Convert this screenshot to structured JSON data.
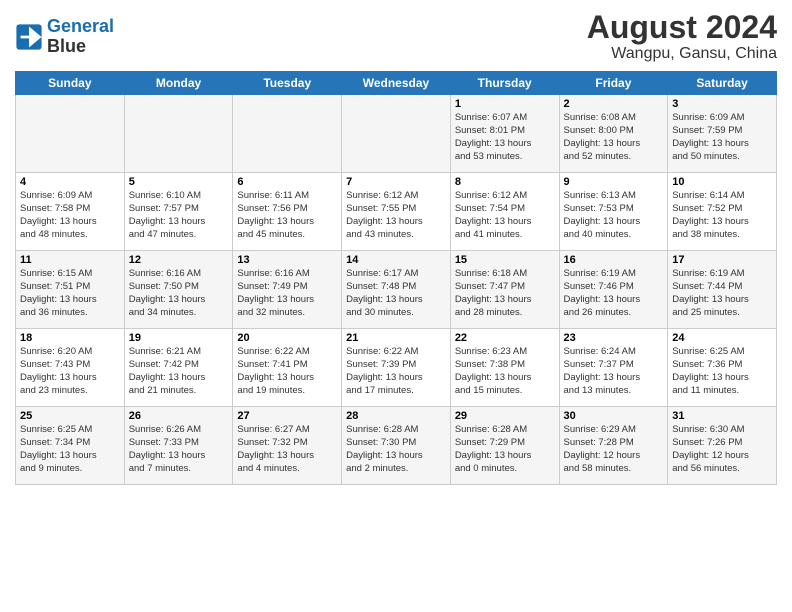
{
  "header": {
    "logo_line1": "General",
    "logo_line2": "Blue",
    "month_year": "August 2024",
    "location": "Wangpu, Gansu, China"
  },
  "weekdays": [
    "Sunday",
    "Monday",
    "Tuesday",
    "Wednesday",
    "Thursday",
    "Friday",
    "Saturday"
  ],
  "weeks": [
    [
      {
        "day": "",
        "info": ""
      },
      {
        "day": "",
        "info": ""
      },
      {
        "day": "",
        "info": ""
      },
      {
        "day": "",
        "info": ""
      },
      {
        "day": "1",
        "info": "Sunrise: 6:07 AM\nSunset: 8:01 PM\nDaylight: 13 hours\nand 53 minutes."
      },
      {
        "day": "2",
        "info": "Sunrise: 6:08 AM\nSunset: 8:00 PM\nDaylight: 13 hours\nand 52 minutes."
      },
      {
        "day": "3",
        "info": "Sunrise: 6:09 AM\nSunset: 7:59 PM\nDaylight: 13 hours\nand 50 minutes."
      }
    ],
    [
      {
        "day": "4",
        "info": "Sunrise: 6:09 AM\nSunset: 7:58 PM\nDaylight: 13 hours\nand 48 minutes."
      },
      {
        "day": "5",
        "info": "Sunrise: 6:10 AM\nSunset: 7:57 PM\nDaylight: 13 hours\nand 47 minutes."
      },
      {
        "day": "6",
        "info": "Sunrise: 6:11 AM\nSunset: 7:56 PM\nDaylight: 13 hours\nand 45 minutes."
      },
      {
        "day": "7",
        "info": "Sunrise: 6:12 AM\nSunset: 7:55 PM\nDaylight: 13 hours\nand 43 minutes."
      },
      {
        "day": "8",
        "info": "Sunrise: 6:12 AM\nSunset: 7:54 PM\nDaylight: 13 hours\nand 41 minutes."
      },
      {
        "day": "9",
        "info": "Sunrise: 6:13 AM\nSunset: 7:53 PM\nDaylight: 13 hours\nand 40 minutes."
      },
      {
        "day": "10",
        "info": "Sunrise: 6:14 AM\nSunset: 7:52 PM\nDaylight: 13 hours\nand 38 minutes."
      }
    ],
    [
      {
        "day": "11",
        "info": "Sunrise: 6:15 AM\nSunset: 7:51 PM\nDaylight: 13 hours\nand 36 minutes."
      },
      {
        "day": "12",
        "info": "Sunrise: 6:16 AM\nSunset: 7:50 PM\nDaylight: 13 hours\nand 34 minutes."
      },
      {
        "day": "13",
        "info": "Sunrise: 6:16 AM\nSunset: 7:49 PM\nDaylight: 13 hours\nand 32 minutes."
      },
      {
        "day": "14",
        "info": "Sunrise: 6:17 AM\nSunset: 7:48 PM\nDaylight: 13 hours\nand 30 minutes."
      },
      {
        "day": "15",
        "info": "Sunrise: 6:18 AM\nSunset: 7:47 PM\nDaylight: 13 hours\nand 28 minutes."
      },
      {
        "day": "16",
        "info": "Sunrise: 6:19 AM\nSunset: 7:46 PM\nDaylight: 13 hours\nand 26 minutes."
      },
      {
        "day": "17",
        "info": "Sunrise: 6:19 AM\nSunset: 7:44 PM\nDaylight: 13 hours\nand 25 minutes."
      }
    ],
    [
      {
        "day": "18",
        "info": "Sunrise: 6:20 AM\nSunset: 7:43 PM\nDaylight: 13 hours\nand 23 minutes."
      },
      {
        "day": "19",
        "info": "Sunrise: 6:21 AM\nSunset: 7:42 PM\nDaylight: 13 hours\nand 21 minutes."
      },
      {
        "day": "20",
        "info": "Sunrise: 6:22 AM\nSunset: 7:41 PM\nDaylight: 13 hours\nand 19 minutes."
      },
      {
        "day": "21",
        "info": "Sunrise: 6:22 AM\nSunset: 7:39 PM\nDaylight: 13 hours\nand 17 minutes."
      },
      {
        "day": "22",
        "info": "Sunrise: 6:23 AM\nSunset: 7:38 PM\nDaylight: 13 hours\nand 15 minutes."
      },
      {
        "day": "23",
        "info": "Sunrise: 6:24 AM\nSunset: 7:37 PM\nDaylight: 13 hours\nand 13 minutes."
      },
      {
        "day": "24",
        "info": "Sunrise: 6:25 AM\nSunset: 7:36 PM\nDaylight: 13 hours\nand 11 minutes."
      }
    ],
    [
      {
        "day": "25",
        "info": "Sunrise: 6:25 AM\nSunset: 7:34 PM\nDaylight: 13 hours\nand 9 minutes."
      },
      {
        "day": "26",
        "info": "Sunrise: 6:26 AM\nSunset: 7:33 PM\nDaylight: 13 hours\nand 7 minutes."
      },
      {
        "day": "27",
        "info": "Sunrise: 6:27 AM\nSunset: 7:32 PM\nDaylight: 13 hours\nand 4 minutes."
      },
      {
        "day": "28",
        "info": "Sunrise: 6:28 AM\nSunset: 7:30 PM\nDaylight: 13 hours\nand 2 minutes."
      },
      {
        "day": "29",
        "info": "Sunrise: 6:28 AM\nSunset: 7:29 PM\nDaylight: 13 hours\nand 0 minutes."
      },
      {
        "day": "30",
        "info": "Sunrise: 6:29 AM\nSunset: 7:28 PM\nDaylight: 12 hours\nand 58 minutes."
      },
      {
        "day": "31",
        "info": "Sunrise: 6:30 AM\nSunset: 7:26 PM\nDaylight: 12 hours\nand 56 minutes."
      }
    ]
  ]
}
